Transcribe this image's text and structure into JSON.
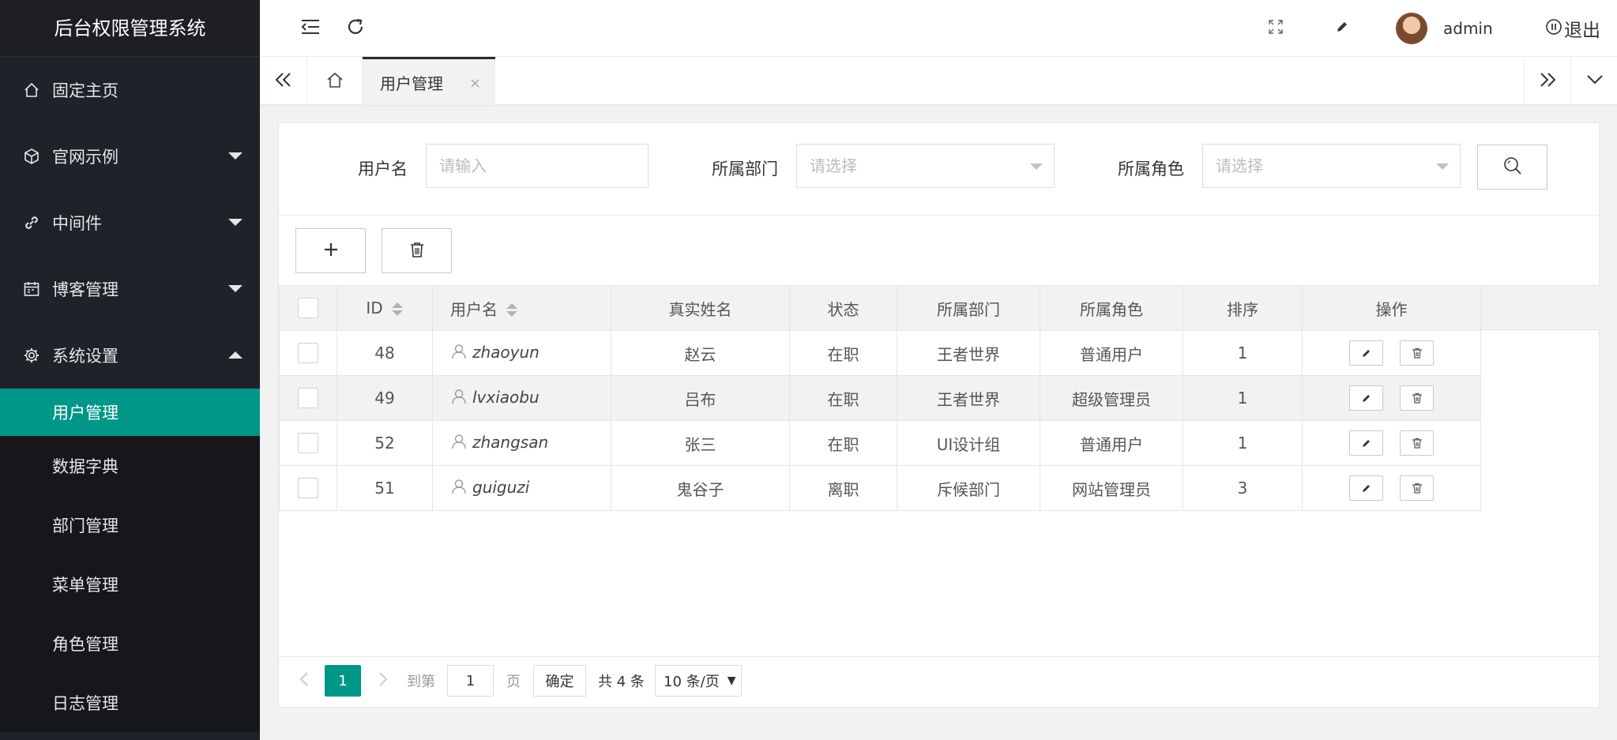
{
  "app": {
    "title": "后台权限管理系统"
  },
  "sidebar": {
    "items": [
      {
        "label": "固定主页",
        "icon": "home-icon"
      },
      {
        "label": "官网示例",
        "icon": "cube-icon"
      },
      {
        "label": "中间件",
        "icon": "link-icon"
      },
      {
        "label": "博客管理",
        "icon": "calendar-icon"
      },
      {
        "label": "系统设置",
        "icon": "gear-icon"
      }
    ],
    "sub_items": [
      {
        "label": "用户管理",
        "active": true
      },
      {
        "label": "数据字典"
      },
      {
        "label": "部门管理"
      },
      {
        "label": "菜单管理"
      },
      {
        "label": "角色管理"
      },
      {
        "label": "日志管理"
      }
    ]
  },
  "header": {
    "user": "admin",
    "logout": "退出"
  },
  "tabs": {
    "active": "用户管理",
    "close": "×"
  },
  "search": {
    "username_label": "用户名",
    "username_placeholder": "请输入",
    "dept_label": "所属部门",
    "dept_placeholder": "请选择",
    "role_label": "所属角色",
    "role_placeholder": "请选择"
  },
  "table": {
    "columns": [
      "ID",
      "用户名",
      "真实姓名",
      "状态",
      "所属部门",
      "所属角色",
      "排序",
      "操作"
    ],
    "rows": [
      {
        "id": "48",
        "username": "zhaoyun",
        "realname": "赵云",
        "status": "在职",
        "dept": "王者世界",
        "role": "普通用户",
        "sort": "1"
      },
      {
        "id": "49",
        "username": "lvxiaobu",
        "realname": "吕布",
        "status": "在职",
        "dept": "王者世界",
        "role": "超级管理员",
        "sort": "1"
      },
      {
        "id": "52",
        "username": "zhangsan",
        "realname": "张三",
        "status": "在职",
        "dept": "UI设计组",
        "role": "普通用户",
        "sort": "1"
      },
      {
        "id": "51",
        "username": "guiguzi",
        "realname": "鬼谷子",
        "status": "离职",
        "dept": "斥候部门",
        "role": "网站管理员",
        "sort": "3"
      }
    ]
  },
  "pager": {
    "current": "1",
    "goto_label": "到第",
    "goto_value": "1",
    "page_unit": "页",
    "confirm": "确定",
    "total": "共 4 条",
    "page_size": "10 条/页"
  },
  "colors": {
    "accent": "#009688",
    "sidebar_bg": "#20222a"
  }
}
